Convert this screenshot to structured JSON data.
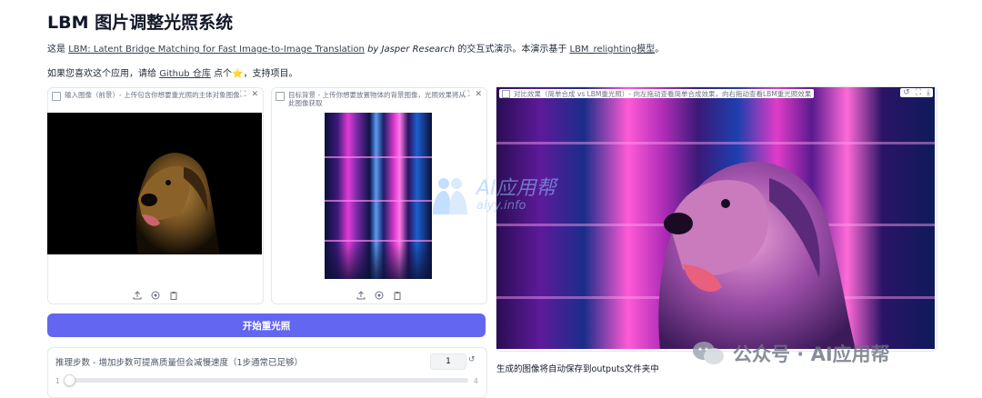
{
  "title": "LBM 图片调整光照系统",
  "intro": {
    "prefix": "这是 ",
    "paper_link": "LBM: Latent Bridge Matching for Fast Image-to-Image Translation",
    "by": " by Jasper Research",
    "middle": " 的交互式演示。本演示基于 ",
    "model_link": "LBM_relighting模型",
    "end": "。",
    "line2_prefix": "如果您喜欢这个应用，请给 ",
    "github_link": "Github 仓库",
    "line2_middle": " 点个",
    "star": "⭐",
    "line2_end": "，支持项目。"
  },
  "input_panel": {
    "label": "输入图像（前景）- 上传包含你想要重光照的主体对象图像",
    "tools": [
      "⛶",
      "✕"
    ],
    "upload_icons": [
      "upload-icon",
      "webcam-icon",
      "clipboard-icon"
    ]
  },
  "bg_panel": {
    "label": "目标背景 - 上传你想要放置物体的背景图像，光照效果将从此图像获取",
    "tools": [
      "⛶",
      "✕"
    ],
    "upload_icons": [
      "upload-icon",
      "webcam-icon",
      "clipboard-icon"
    ]
  },
  "output_panel": {
    "label": "对比效果（简单合成 vs LBM重光照）- 向左拖动查看简单合成效果，向右拖动查看LBM重光照效果",
    "tools": [
      "↺",
      "⛶",
      "⤓"
    ]
  },
  "run_button": "开始重光照",
  "slider": {
    "label": "推理步数 - 增加步数可提高质量但会减慢速度（1步通常已足够）",
    "value": "1",
    "min": "1",
    "max": "4",
    "level_fraction": 0.0
  },
  "note": "生成的图像将自动保存到outputs文件夹中",
  "watermark_center": {
    "text": "AI应用帮",
    "sub": "aiyy.info"
  },
  "watermark_bottom": {
    "text": "公众号 · AI应用帮"
  },
  "colors": {
    "primary": "#6366f1",
    "border": "#e5e7eb"
  }
}
